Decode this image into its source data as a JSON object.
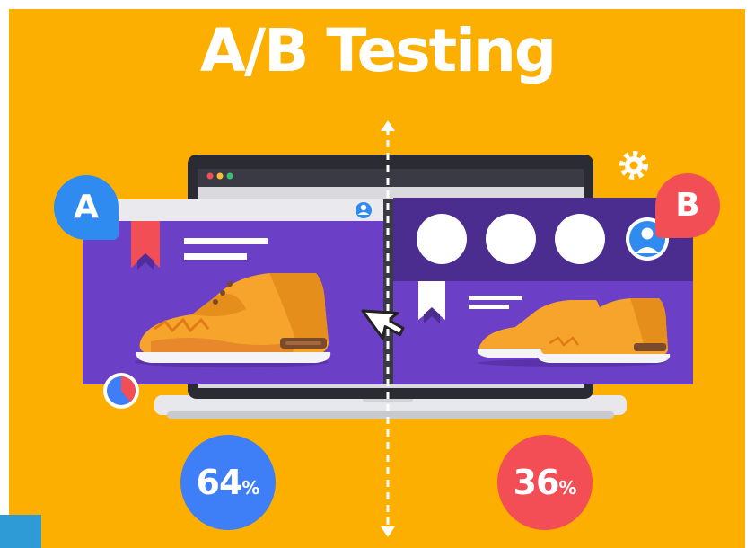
{
  "title": "A/B Testing",
  "variant_a": {
    "label": "A",
    "percent": "64",
    "unit": "%",
    "share": 0.64
  },
  "variant_b": {
    "label": "B",
    "percent": "36",
    "unit": "%",
    "share": 0.36
  },
  "colors": {
    "background": "#FDAF00",
    "variant_a": "#3E7EF6",
    "variant_b": "#F34D55",
    "panel_purple": "#6B3FC6",
    "panel_dark_purple": "#4F2D9A",
    "shoe_orange": "#F7A42C"
  },
  "icons": [
    "gear-icon",
    "user-avatar-icon",
    "bookmark-icon",
    "cursor-icon",
    "pie-chart-icon",
    "double-arrow-icon"
  ]
}
